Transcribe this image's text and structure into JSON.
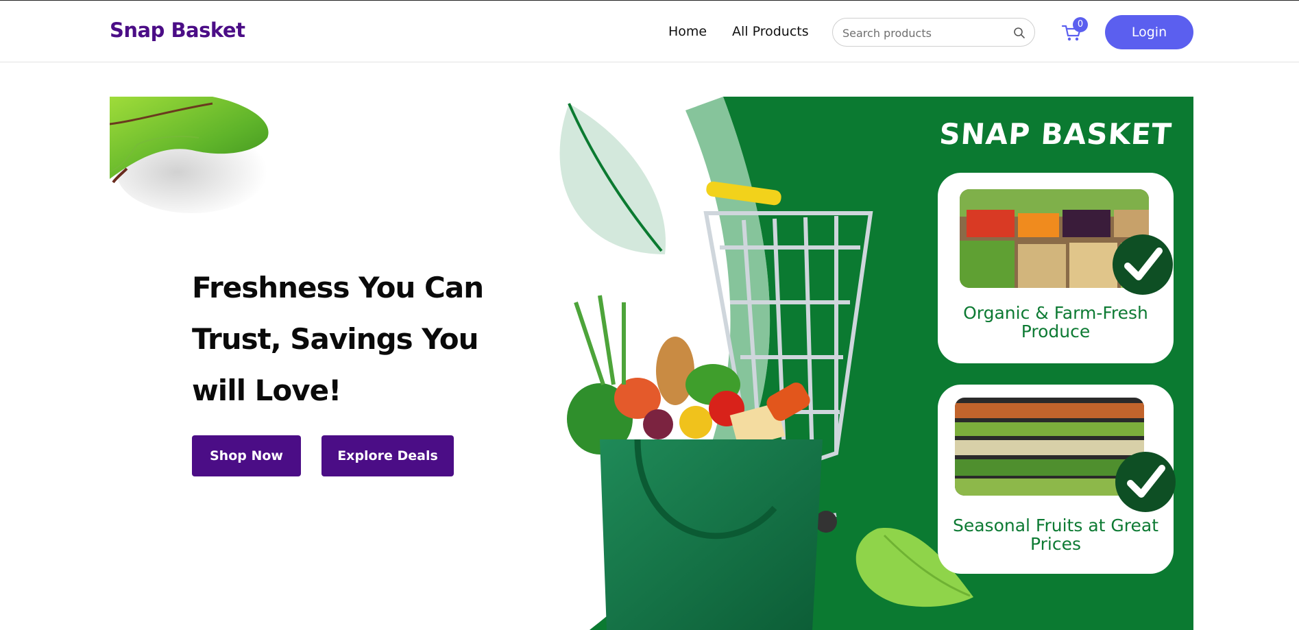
{
  "header": {
    "brand": "Snap Basket",
    "nav": {
      "home": "Home",
      "all_products": "All Products"
    },
    "search": {
      "placeholder": "Search products",
      "icon": "search-icon"
    },
    "cart": {
      "icon": "cart-icon",
      "count": "0"
    },
    "login_label": "Login"
  },
  "hero": {
    "title": "Freshness You Can Trust, Savings You will Love!",
    "buttons": {
      "shop_now": "Shop Now",
      "explore_deals": "Explore Deals"
    }
  },
  "banner": {
    "title": "SNAP BASKET",
    "cards": [
      {
        "text": "Organic & Farm-Fresh Produce",
        "icon": "check-icon"
      },
      {
        "text": "Seasonal Fruits at Great Prices",
        "icon": "check-icon"
      }
    ]
  },
  "colors": {
    "brand_purple": "#4b0d86",
    "accent_blue": "#5b5fef",
    "banner_green": "#0b7a31",
    "card_text_green": "#0d7a33"
  }
}
